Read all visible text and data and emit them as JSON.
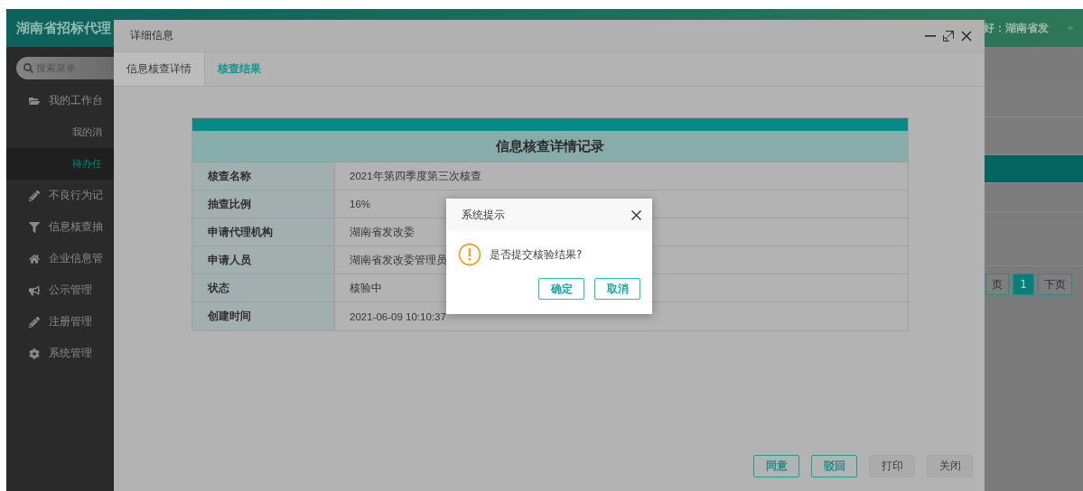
{
  "header": {
    "title": "湖南省招标代理",
    "greeting": "好：湖南省发"
  },
  "sidebar": {
    "search": {
      "placeholder": "搜索菜单"
    },
    "items": [
      {
        "label": "我的工作台",
        "selected": false,
        "expanded": true,
        "children": [
          {
            "label": "我的消",
            "selected": false
          },
          {
            "label": "待办任",
            "selected": true
          }
        ]
      },
      {
        "label": "不良行为记",
        "selected": false
      },
      {
        "label": "信息核查抽",
        "selected": false
      },
      {
        "label": "企业信息管",
        "selected": false
      },
      {
        "label": "公示管理",
        "selected": false
      },
      {
        "label": "注册管理",
        "selected": false
      },
      {
        "label": "系统管理",
        "selected": false
      }
    ]
  },
  "list": {
    "rows": [
      {
        "selected": false
      },
      {
        "selected": false
      },
      {
        "selected": true
      },
      {
        "selected": false
      },
      {
        "selected": false
      }
    ],
    "pagination": [
      {
        "label": "页",
        "selected": false
      },
      {
        "label": "1",
        "selected": true
      },
      {
        "label": "下页",
        "selected": false
      }
    ]
  },
  "detail_window": {
    "title": "详细信息",
    "tabs": [
      {
        "label": "信息核查详情",
        "selected": true
      },
      {
        "label": "核查结果",
        "selected": false
      }
    ],
    "record": {
      "title": "信息核查详情记录",
      "rows": [
        {
          "label": "核查名称",
          "value": "2021年第四季度第三次核查"
        },
        {
          "label": "抽查比例",
          "value": "16%"
        },
        {
          "label": "申请代理机构",
          "value": "湖南省发改委"
        },
        {
          "label": "申请人员",
          "value": "湖南省发改委管理员"
        },
        {
          "label": "状态",
          "value": "核验中"
        },
        {
          "label": "创建时间",
          "value": "2021-06-09 10:10:37"
        }
      ]
    },
    "buttons": [
      {
        "label": "同意",
        "kind": "primary"
      },
      {
        "label": "驳回",
        "kind": "primary"
      },
      {
        "label": "打印",
        "kind": "default"
      },
      {
        "label": "关闭",
        "kind": "default"
      }
    ]
  },
  "dialog": {
    "title": "系统提示",
    "message": "是否提交核验结果?",
    "buttons": [
      {
        "label": "确定"
      },
      {
        "label": "取消"
      }
    ]
  }
}
